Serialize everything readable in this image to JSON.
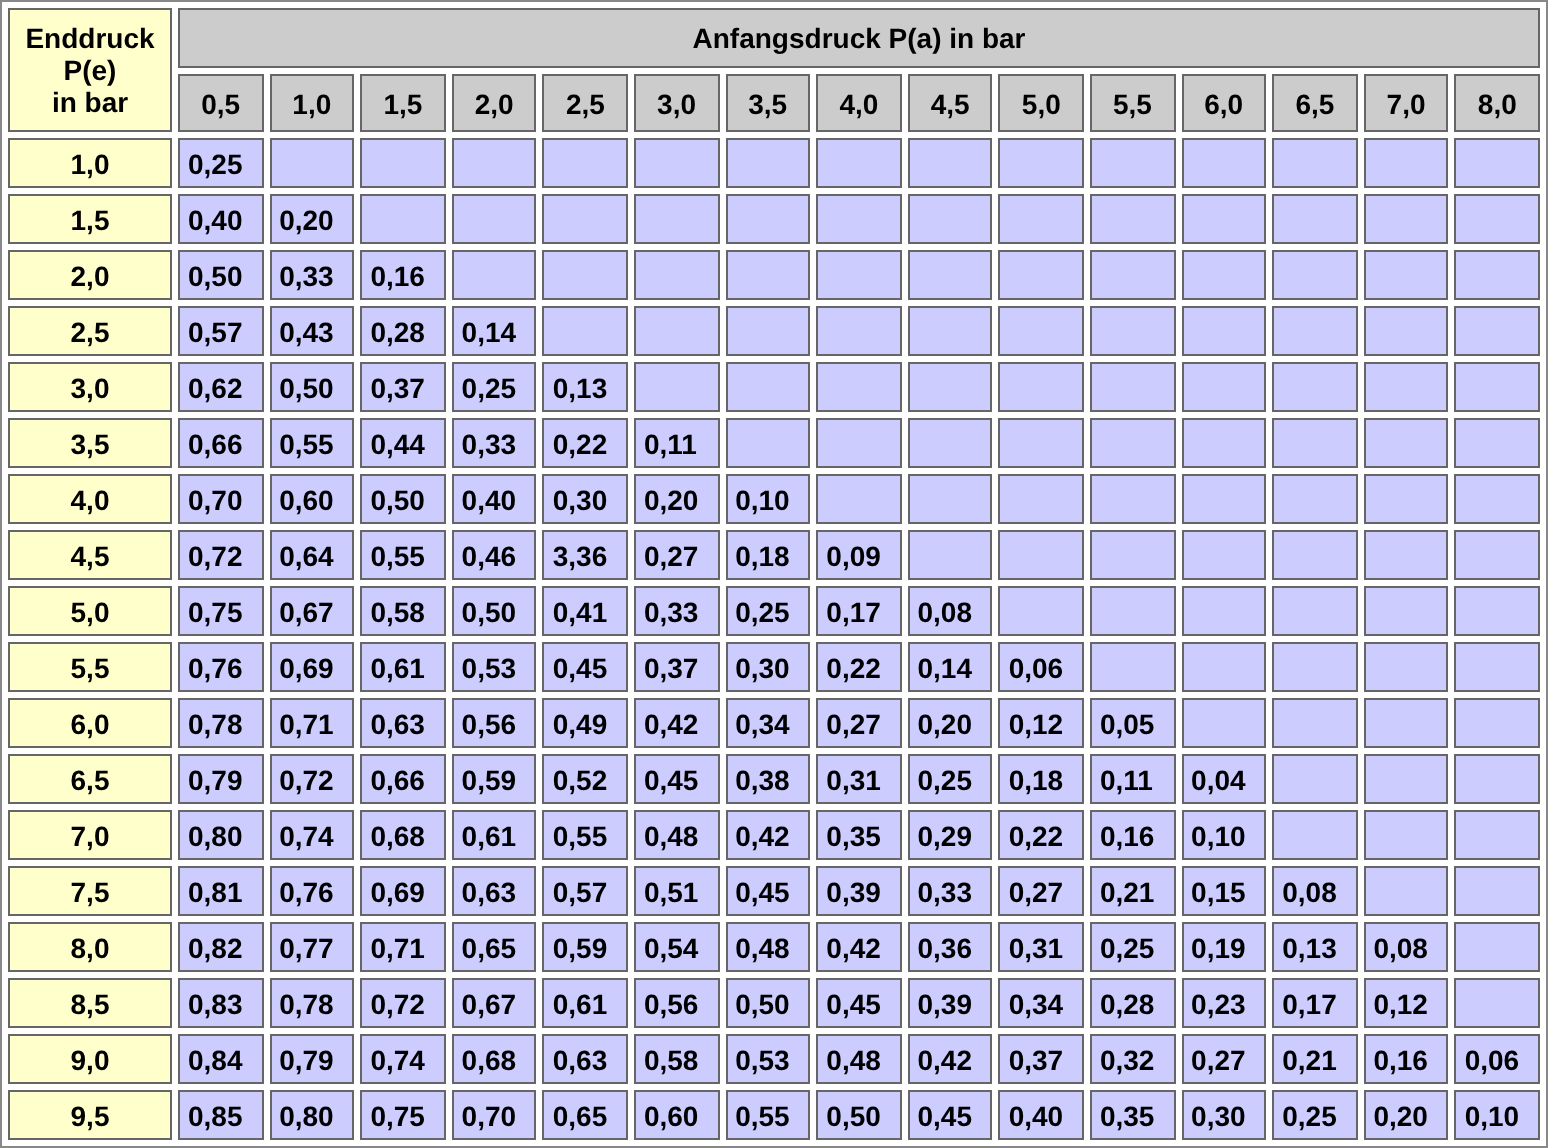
{
  "table": {
    "corner_header": "Enddruck\nP(e)\nin bar",
    "group_header": "Anfangsdruck P(a) in bar",
    "columns": [
      "0,5",
      "1,0",
      "1,5",
      "2,0",
      "2,5",
      "3,0",
      "3,5",
      "4,0",
      "4,5",
      "5,0",
      "5,5",
      "6,0",
      "6,5",
      "7,0",
      "8,0"
    ],
    "rows": [
      {
        "label": "1,0",
        "values": [
          "0,25"
        ]
      },
      {
        "label": "1,5",
        "values": [
          "0,40",
          "0,20"
        ]
      },
      {
        "label": "2,0",
        "values": [
          "0,50",
          "0,33",
          "0,16"
        ]
      },
      {
        "label": "2,5",
        "values": [
          "0,57",
          "0,43",
          "0,28",
          "0,14"
        ]
      },
      {
        "label": "3,0",
        "values": [
          "0,62",
          "0,50",
          "0,37",
          "0,25",
          "0,13"
        ]
      },
      {
        "label": "3,5",
        "values": [
          "0,66",
          "0,55",
          "0,44",
          "0,33",
          "0,22",
          "0,11"
        ]
      },
      {
        "label": "4,0",
        "values": [
          "0,70",
          "0,60",
          "0,50",
          "0,40",
          "0,30",
          "0,20",
          "0,10"
        ]
      },
      {
        "label": "4,5",
        "values": [
          "0,72",
          "0,64",
          "0,55",
          "0,46",
          "3,36",
          "0,27",
          "0,18",
          "0,09"
        ]
      },
      {
        "label": "5,0",
        "values": [
          "0,75",
          "0,67",
          "0,58",
          "0,50",
          "0,41",
          "0,33",
          "0,25",
          "0,17",
          "0,08"
        ]
      },
      {
        "label": "5,5",
        "values": [
          "0,76",
          "0,69",
          "0,61",
          "0,53",
          "0,45",
          "0,37",
          "0,30",
          "0,22",
          "0,14",
          "0,06"
        ]
      },
      {
        "label": "6,0",
        "values": [
          "0,78",
          "0,71",
          "0,63",
          "0,56",
          "0,49",
          "0,42",
          "0,34",
          "0,27",
          "0,20",
          "0,12",
          "0,05"
        ]
      },
      {
        "label": "6,5",
        "values": [
          "0,79",
          "0,72",
          "0,66",
          "0,59",
          "0,52",
          "0,45",
          "0,38",
          "0,31",
          "0,25",
          "0,18",
          "0,11",
          "0,04"
        ]
      },
      {
        "label": "7,0",
        "values": [
          "0,80",
          "0,74",
          "0,68",
          "0,61",
          "0,55",
          "0,48",
          "0,42",
          "0,35",
          "0,29",
          "0,22",
          "0,16",
          "0,10"
        ]
      },
      {
        "label": "7,5",
        "values": [
          "0,81",
          "0,76",
          "0,69",
          "0,63",
          "0,57",
          "0,51",
          "0,45",
          "0,39",
          "0,33",
          "0,27",
          "0,21",
          "0,15",
          "0,08"
        ]
      },
      {
        "label": "8,0",
        "values": [
          "0,82",
          "0,77",
          "0,71",
          "0,65",
          "0,59",
          "0,54",
          "0,48",
          "0,42",
          "0,36",
          "0,31",
          "0,25",
          "0,19",
          "0,13",
          "0,08"
        ]
      },
      {
        "label": "8,5",
        "values": [
          "0,83",
          "0,78",
          "0,72",
          "0,67",
          "0,61",
          "0,56",
          "0,50",
          "0,45",
          "0,39",
          "0,34",
          "0,28",
          "0,23",
          "0,17",
          "0,12"
        ]
      },
      {
        "label": "9,0",
        "values": [
          "0,84",
          "0,79",
          "0,74",
          "0,68",
          "0,63",
          "0,58",
          "0,53",
          "0,48",
          "0,42",
          "0,37",
          "0,32",
          "0,27",
          "0,21",
          "0,16",
          "0,06"
        ]
      },
      {
        "label": "9,5",
        "values": [
          "0,85",
          "0,80",
          "0,75",
          "0,70",
          "0,65",
          "0,60",
          "0,55",
          "0,50",
          "0,45",
          "0,40",
          "0,35",
          "0,30",
          "0,25",
          "0,20",
          "0,10"
        ]
      }
    ]
  }
}
